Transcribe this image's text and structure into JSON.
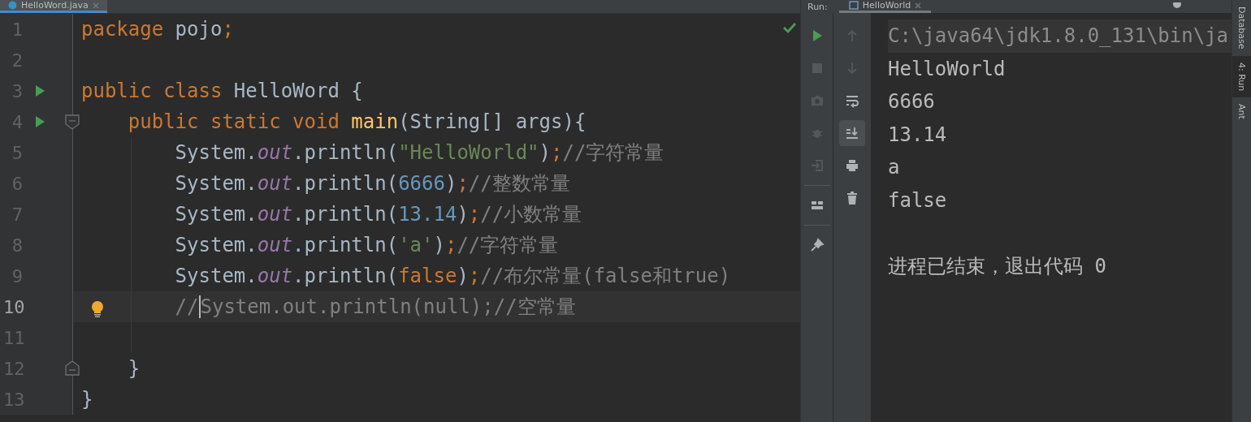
{
  "editor_tab": {
    "label": "HelloWord.java",
    "selected": true
  },
  "editor": {
    "lines": [
      {
        "number": "1",
        "current": false,
        "run_marker": false,
        "lightbulb": false,
        "fold_start": false,
        "fold_end": false,
        "tokens": [
          {
            "kind": "keyword",
            "text": "package "
          },
          {
            "kind": "plain",
            "text": "pojo"
          },
          {
            "kind": "keyword",
            "text": ";"
          }
        ]
      },
      {
        "number": "2",
        "current": false,
        "run_marker": false,
        "lightbulb": false,
        "fold_start": false,
        "fold_end": false
      },
      {
        "number": "3",
        "current": false,
        "run_marker": true,
        "lightbulb": false,
        "fold_start": false,
        "fold_end": false,
        "tokens": [
          {
            "kind": "keyword",
            "text": "public class "
          },
          {
            "kind": "plain",
            "text": "HelloWord {"
          }
        ]
      },
      {
        "number": "4",
        "current": false,
        "run_marker": true,
        "lightbulb": false,
        "fold_start": true,
        "fold_end": false,
        "tokens": [
          {
            "kind": "keyword",
            "text": "    public static void "
          },
          {
            "kind": "method",
            "text": "main"
          },
          {
            "kind": "plain",
            "text": "(String[] args){"
          }
        ]
      },
      {
        "number": "5",
        "current": false,
        "run_marker": false,
        "lightbulb": false,
        "fold_start": false,
        "fold_end": false,
        "tokens": [
          {
            "kind": "plain",
            "text": "        System."
          },
          {
            "kind": "field",
            "text": "out"
          },
          {
            "kind": "plain",
            "text": ".println("
          },
          {
            "kind": "string",
            "text": "\"HelloWorld\""
          },
          {
            "kind": "plain",
            "text": ")"
          },
          {
            "kind": "keyword",
            "text": ";"
          },
          {
            "kind": "comment",
            "text": "//字符常量"
          }
        ]
      },
      {
        "number": "6",
        "current": false,
        "run_marker": false,
        "lightbulb": false,
        "fold_start": false,
        "fold_end": false,
        "tokens": [
          {
            "kind": "plain",
            "text": "        System."
          },
          {
            "kind": "field",
            "text": "out"
          },
          {
            "kind": "plain",
            "text": ".println("
          },
          {
            "kind": "number",
            "text": "6666"
          },
          {
            "kind": "plain",
            "text": ")"
          },
          {
            "kind": "keyword",
            "text": ";"
          },
          {
            "kind": "comment",
            "text": "//整数常量"
          }
        ]
      },
      {
        "number": "7",
        "current": false,
        "run_marker": false,
        "lightbulb": false,
        "fold_start": false,
        "fold_end": false,
        "tokens": [
          {
            "kind": "plain",
            "text": "        System."
          },
          {
            "kind": "field",
            "text": "out"
          },
          {
            "kind": "plain",
            "text": ".println("
          },
          {
            "kind": "number",
            "text": "13.14"
          },
          {
            "kind": "plain",
            "text": ")"
          },
          {
            "kind": "keyword",
            "text": ";"
          },
          {
            "kind": "comment",
            "text": "//小数常量"
          }
        ]
      },
      {
        "number": "8",
        "current": false,
        "run_marker": false,
        "lightbulb": false,
        "fold_start": false,
        "fold_end": false,
        "tokens": [
          {
            "kind": "plain",
            "text": "        System."
          },
          {
            "kind": "field",
            "text": "out"
          },
          {
            "kind": "plain",
            "text": ".println("
          },
          {
            "kind": "string",
            "text": "'a'"
          },
          {
            "kind": "plain",
            "text": ")"
          },
          {
            "kind": "keyword",
            "text": ";"
          },
          {
            "kind": "comment",
            "text": "//字符常量"
          }
        ]
      },
      {
        "number": "9",
        "current": false,
        "run_marker": false,
        "lightbulb": false,
        "fold_start": false,
        "fold_end": false,
        "tokens": [
          {
            "kind": "plain",
            "text": "        System."
          },
          {
            "kind": "field",
            "text": "out"
          },
          {
            "kind": "plain",
            "text": ".println("
          },
          {
            "kind": "keyword",
            "text": "false"
          },
          {
            "kind": "plain",
            "text": ")"
          },
          {
            "kind": "keyword",
            "text": ";"
          },
          {
            "kind": "comment",
            "text": "//布尔常量(false和true)"
          }
        ]
      },
      {
        "number": "10",
        "current": true,
        "run_marker": false,
        "lightbulb": true,
        "fold_start": false,
        "fold_end": false,
        "tokens": [
          {
            "kind": "comment",
            "text": "        //",
            "caret": true
          },
          {
            "kind": "comment",
            "text": "System.out.println(null);//空常量"
          }
        ]
      },
      {
        "number": "11",
        "current": false,
        "run_marker": false,
        "lightbulb": false,
        "fold_start": false,
        "fold_end": false
      },
      {
        "number": "12",
        "current": false,
        "run_marker": false,
        "lightbulb": false,
        "fold_start": false,
        "fold_end": true,
        "tokens": [
          {
            "kind": "plain",
            "text": "    }"
          }
        ]
      },
      {
        "number": "13",
        "current": false,
        "run_marker": false,
        "lightbulb": false,
        "fold_start": false,
        "fold_end": false,
        "tokens": [
          {
            "kind": "plain",
            "text": "}"
          }
        ]
      }
    ]
  },
  "run_panel": {
    "title": "Run:",
    "tab": {
      "label": "HelloWorld",
      "selected": true
    },
    "toolbar_1": [
      {
        "kind": "run",
        "disabled": false
      },
      {
        "kind": "stop",
        "disabled": true
      },
      {
        "kind": "camera",
        "disabled": true
      },
      {
        "kind": "bug",
        "disabled": true
      },
      {
        "kind": "enter",
        "disabled": true
      },
      {
        "kind": "divider"
      },
      {
        "kind": "layout",
        "disabled": false
      },
      {
        "kind": "divider"
      },
      {
        "kind": "pin",
        "disabled": false
      }
    ],
    "toolbar_2": [
      {
        "kind": "up",
        "disabled": true,
        "selected": false
      },
      {
        "kind": "down",
        "disabled": true,
        "selected": false
      },
      {
        "kind": "wrap",
        "disabled": false,
        "selected": false
      },
      {
        "kind": "scroll-end",
        "disabled": false,
        "selected": true
      },
      {
        "kind": "print",
        "disabled": false,
        "selected": false
      },
      {
        "kind": "trash",
        "disabled": false,
        "selected": false
      }
    ],
    "console": [
      {
        "kind": "command",
        "text": "C:\\java64\\jdk1.8.0_131\\bin\\ja"
      },
      {
        "kind": "output",
        "text": "HelloWorld"
      },
      {
        "kind": "output",
        "text": "6666"
      },
      {
        "kind": "output",
        "text": "13.14"
      },
      {
        "kind": "output",
        "text": "a"
      },
      {
        "kind": "output",
        "text": "false"
      },
      {
        "kind": "output"
      },
      {
        "kind": "output",
        "text": "进程已结束，退出代码 0"
      }
    ]
  },
  "right_stripe": [
    {
      "label": "Database",
      "selected": false
    },
    {
      "label": "4: Run",
      "selected": true
    },
    {
      "label": "Ant",
      "selected": false
    }
  ]
}
